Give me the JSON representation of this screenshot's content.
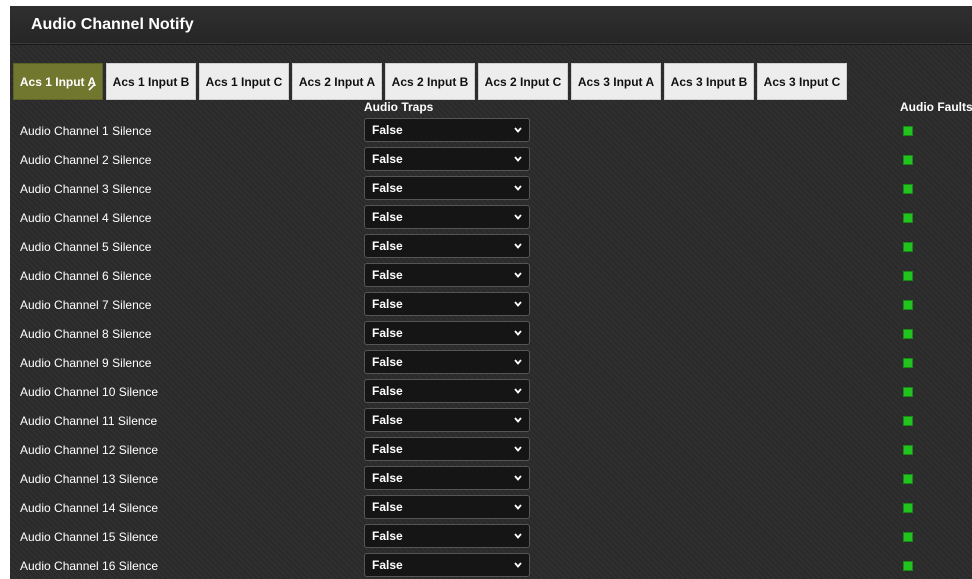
{
  "window": {
    "title": "Audio Channel Notify"
  },
  "tabs": [
    {
      "label": "Acs 1 Input A",
      "active": true
    },
    {
      "label": "Acs 1 Input B",
      "active": false
    },
    {
      "label": "Acs 1 Input C",
      "active": false
    },
    {
      "label": "Acs 2 Input A",
      "active": false
    },
    {
      "label": "Acs 2 Input B",
      "active": false
    },
    {
      "label": "Acs 2 Input C",
      "active": false
    },
    {
      "label": "Acs 3 Input A",
      "active": false
    },
    {
      "label": "Acs 3 Input B",
      "active": false
    },
    {
      "label": "Acs 3 Input C",
      "active": false
    }
  ],
  "columns": {
    "traps": "Audio Traps",
    "faults": "Audio Faults"
  },
  "rows": [
    {
      "label": "Audio Channel 1 Silence",
      "trap": "False",
      "fault": "ok"
    },
    {
      "label": "Audio Channel 2 Silence",
      "trap": "False",
      "fault": "ok"
    },
    {
      "label": "Audio Channel 3 Silence",
      "trap": "False",
      "fault": "ok"
    },
    {
      "label": "Audio Channel 4 Silence",
      "trap": "False",
      "fault": "ok"
    },
    {
      "label": "Audio Channel 5 Silence",
      "trap": "False",
      "fault": "ok"
    },
    {
      "label": "Audio Channel 6 Silence",
      "trap": "False",
      "fault": "ok"
    },
    {
      "label": "Audio Channel 7 Silence",
      "trap": "False",
      "fault": "ok"
    },
    {
      "label": "Audio Channel 8 Silence",
      "trap": "False",
      "fault": "ok"
    },
    {
      "label": "Audio Channel 9 Silence",
      "trap": "False",
      "fault": "ok"
    },
    {
      "label": "Audio Channel 10 Silence",
      "trap": "False",
      "fault": "ok"
    },
    {
      "label": "Audio Channel 11 Silence",
      "trap": "False",
      "fault": "ok"
    },
    {
      "label": "Audio Channel 12 Silence",
      "trap": "False",
      "fault": "ok"
    },
    {
      "label": "Audio Channel 13 Silence",
      "trap": "False",
      "fault": "ok"
    },
    {
      "label": "Audio Channel 14 Silence",
      "trap": "False",
      "fault": "ok"
    },
    {
      "label": "Audio Channel 15 Silence",
      "trap": "False",
      "fault": "ok"
    },
    {
      "label": "Audio Channel 16 Silence",
      "trap": "False",
      "fault": "ok"
    }
  ],
  "colors": {
    "active_tab": "#71772f",
    "fault_ok": "#22c21f",
    "panel_bg": "#2b2b2b"
  },
  "icons": {
    "active_tab_edit": "pencil-icon",
    "dropdown": "chevron-down-icon"
  }
}
